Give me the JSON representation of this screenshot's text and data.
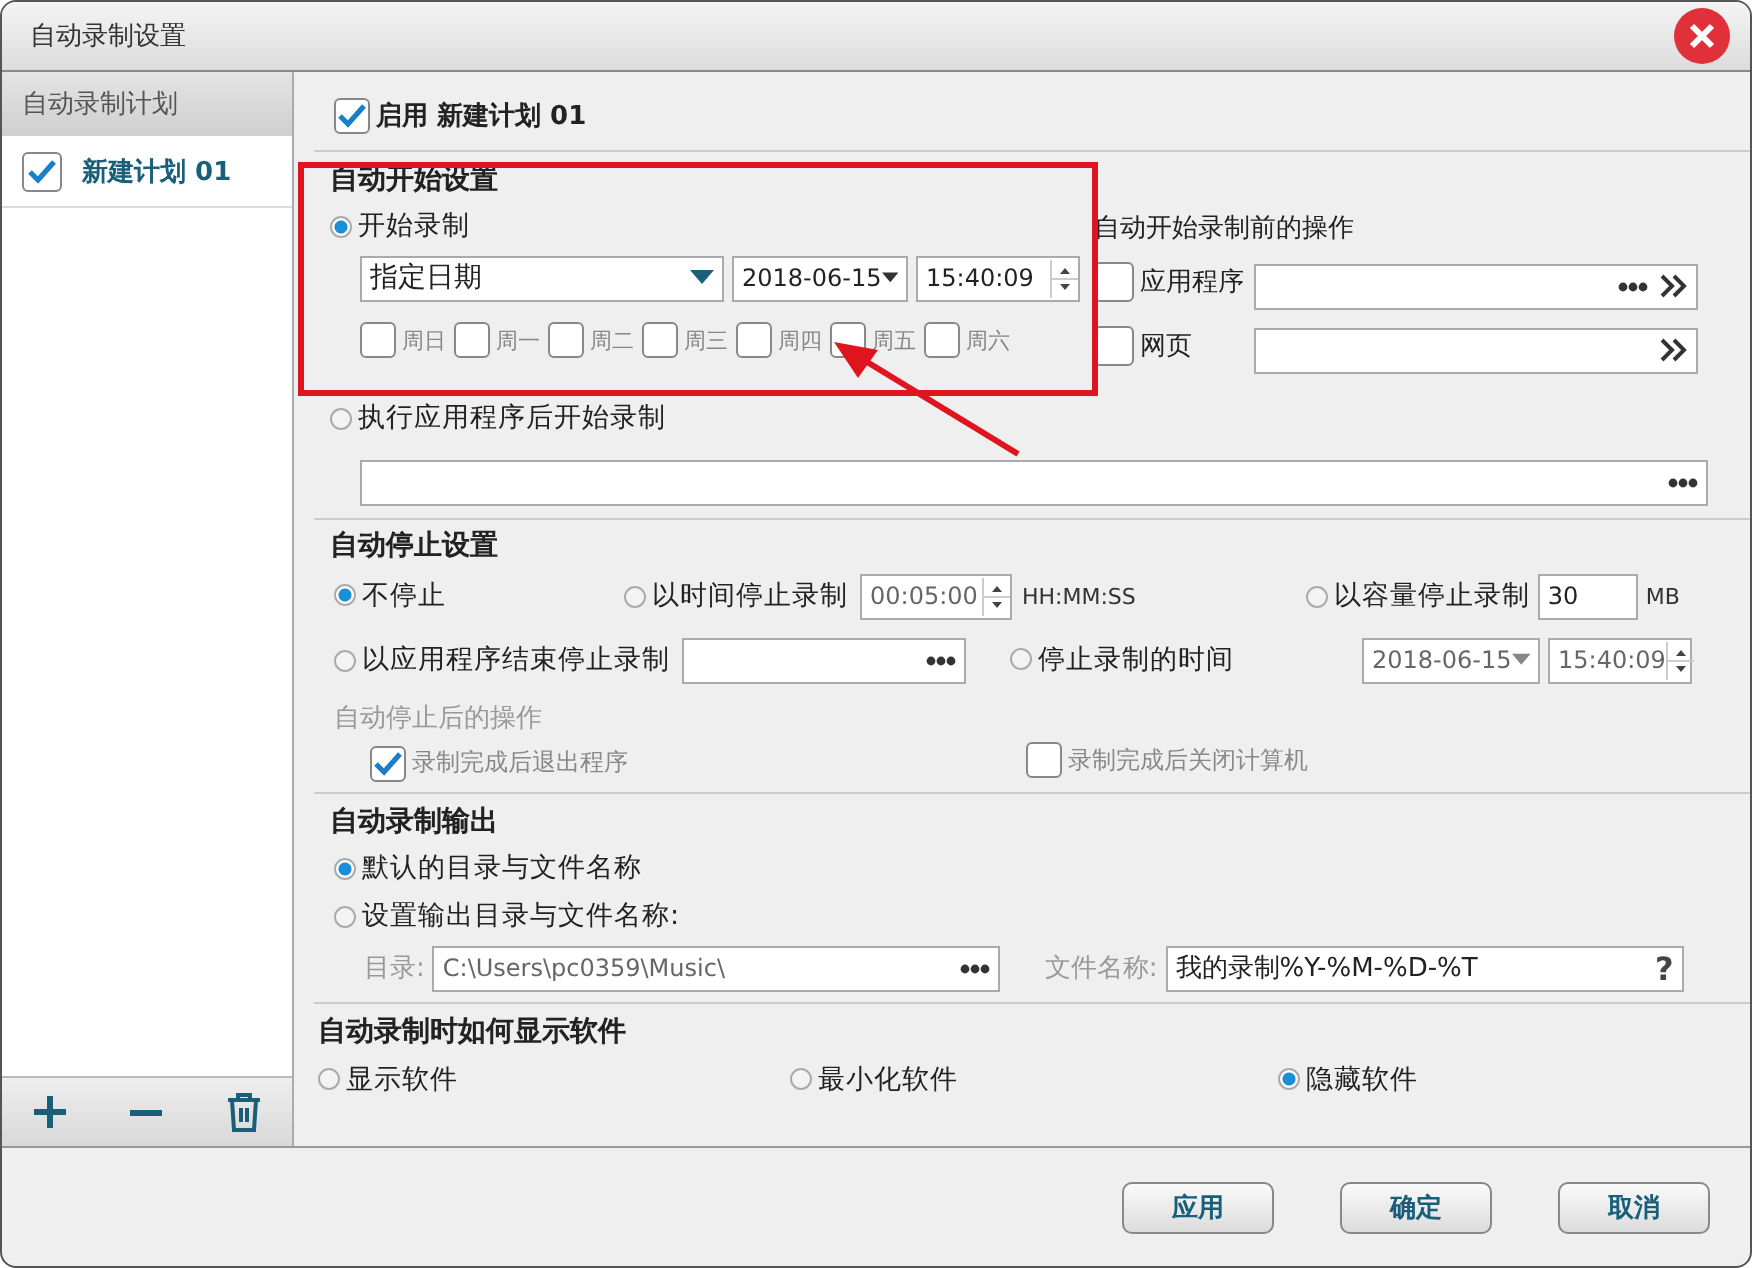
{
  "window": {
    "title": "自动录制设置"
  },
  "sidebar": {
    "header": "自动录制计划",
    "items": [
      {
        "label": "新建计划 01",
        "checked": true,
        "selected": true
      }
    ]
  },
  "enable_plan": {
    "label": "启用 新建计划 01",
    "checked": true
  },
  "auto_start": {
    "title": "自动开始设置",
    "start_option": {
      "label": "开始录制",
      "selected": true
    },
    "date_mode": "指定日期",
    "date": "2018-06-15",
    "time": "15:40:09",
    "weekdays_disabled": true,
    "weekdays": [
      {
        "label": "周日",
        "checked": false
      },
      {
        "label": "周一",
        "checked": false
      },
      {
        "label": "周二",
        "checked": false
      },
      {
        "label": "周三",
        "checked": false
      },
      {
        "label": "周四",
        "checked": false
      },
      {
        "label": "周五",
        "checked": false
      },
      {
        "label": "周六",
        "checked": false
      }
    ],
    "after_app_option": {
      "label": "执行应用程序后开始录制",
      "selected": false
    }
  },
  "pre_actions": {
    "title": "自动开始录制前的操作",
    "items": [
      {
        "label": "应用程序",
        "checked": false,
        "kind": "browse"
      },
      {
        "label": "网页",
        "checked": false,
        "kind": "go"
      }
    ]
  },
  "auto_stop": {
    "title": "自动停止设置",
    "never": {
      "label": "不停止",
      "selected": true
    },
    "by_time": {
      "label": "以时间停止录制",
      "selected": false,
      "value": "00:05:00",
      "unit": "HH:MM:SS"
    },
    "by_size": {
      "label": "以容量停止录制",
      "selected": false,
      "value": "30",
      "unit": "MB"
    },
    "by_app": {
      "label": "以应用程序结束停止录制",
      "selected": false
    },
    "at_time": {
      "label": "停止录制的时间",
      "selected": false,
      "date": "2018-06-15",
      "time": "15:40:09"
    },
    "after_title": "自动停止后的操作",
    "after_disabled": true,
    "after_actions": [
      {
        "label": "录制完成后退出程序",
        "checked": true
      },
      {
        "label": "录制完成后关闭计算机",
        "checked": false
      }
    ]
  },
  "output": {
    "title": "自动录制输出",
    "options": [
      {
        "label": "默认的目录与文件名称",
        "selected": true
      },
      {
        "label": "设置输出目录与文件名称:",
        "selected": false
      }
    ],
    "dir_label": "目录:",
    "dir": "C:\\Users\\pc0359\\Music\\",
    "name_label": "文件名称:",
    "name": "我的录制%Y-%M-%D-%T",
    "help": "?"
  },
  "display": {
    "title": "自动录制时如何显示软件",
    "options": [
      {
        "label": "显示软件",
        "selected": false
      },
      {
        "label": "最小化软件",
        "selected": false
      },
      {
        "label": "隐藏软件",
        "selected": true
      }
    ]
  },
  "buttons": [
    "应用",
    "确定",
    "取消"
  ]
}
